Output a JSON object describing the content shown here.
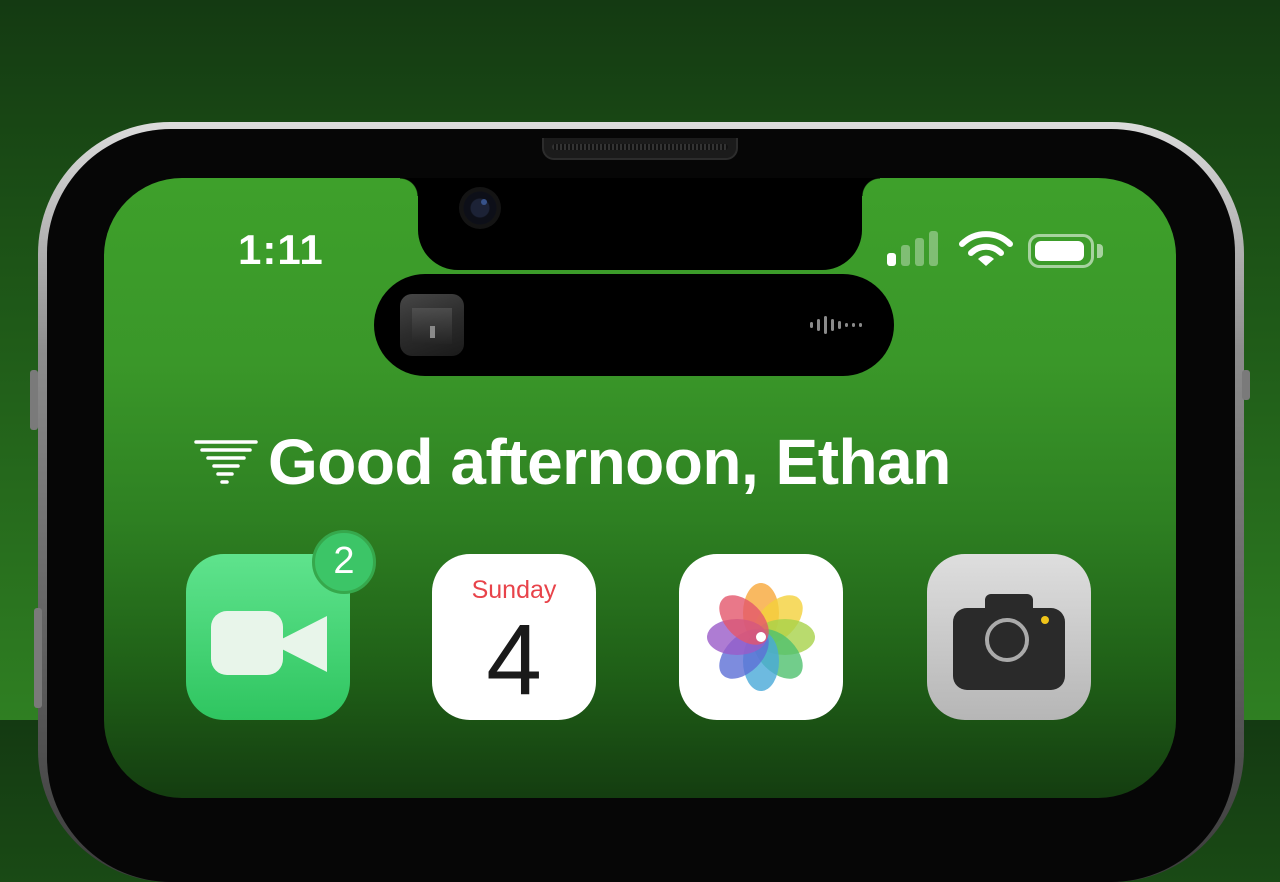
{
  "status_bar": {
    "time": "1:11",
    "signal_bars_active": 1,
    "signal_bars_total": 4,
    "wifi_icon": "wifi-icon",
    "battery_level": 0.9
  },
  "dynamic_island": {
    "activity": "now-playing",
    "artwork_icon": "album-artwork",
    "indicator_icon": "audio-waveform-icon"
  },
  "greeting": {
    "icon": "tornado-icon",
    "text": "Good afternoon, Ethan"
  },
  "apps": [
    {
      "name": "FaceTime",
      "icon": "facetime-icon",
      "badge": "2",
      "color": "#34c759"
    },
    {
      "name": "Calendar",
      "icon": "calendar-icon",
      "weekday": "Sunday",
      "date": "4",
      "accent": "#e8434a"
    },
    {
      "name": "Photos",
      "icon": "photos-icon"
    },
    {
      "name": "Camera",
      "icon": "camera-icon"
    }
  ],
  "colors": {
    "wallpaper": "#3a9729",
    "background": "#1f5a18",
    "frame": "#5f5f5f"
  }
}
